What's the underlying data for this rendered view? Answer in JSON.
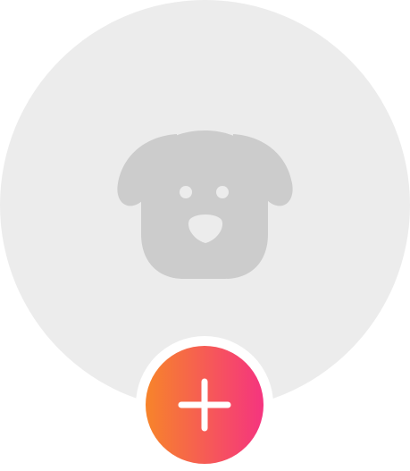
{
  "avatar": {
    "placeholder_icon": "dog-face-icon",
    "background_color": "#ececec",
    "icon_color": "#cccccc",
    "eye_nose_color": "#ececec"
  },
  "add_button": {
    "icon": "plus-icon",
    "gradient_start": "#f7842a",
    "gradient_end": "#f5347f",
    "icon_color": "#ffffff"
  }
}
